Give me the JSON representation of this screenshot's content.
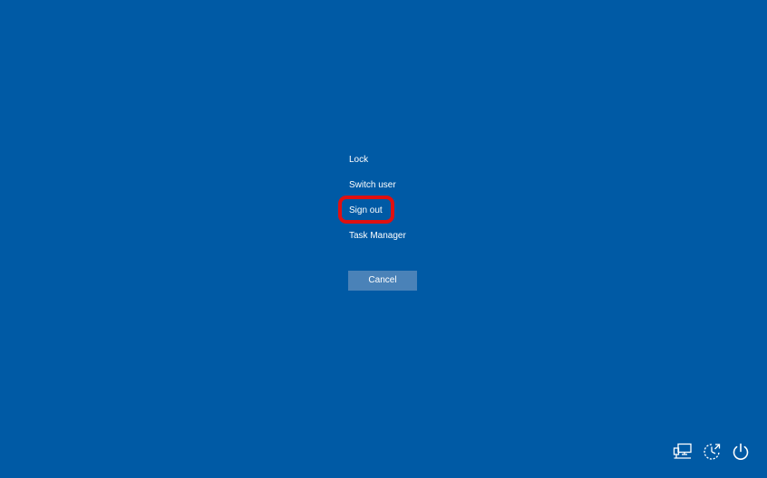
{
  "menu": {
    "items": [
      {
        "label": "Lock"
      },
      {
        "label": "Switch user"
      },
      {
        "label": "Sign out"
      },
      {
        "label": "Task Manager"
      }
    ],
    "highlighted_item": "Sign out",
    "highlight_color": "#e01010"
  },
  "cancel_button": {
    "label": "Cancel"
  },
  "tray": {
    "icons": [
      "network-icon",
      "ease-of-access-icon",
      "power-icon"
    ]
  },
  "colors": {
    "background": "#005aa5",
    "cancel_button": "#4a82b8",
    "text": "#ffffff"
  }
}
